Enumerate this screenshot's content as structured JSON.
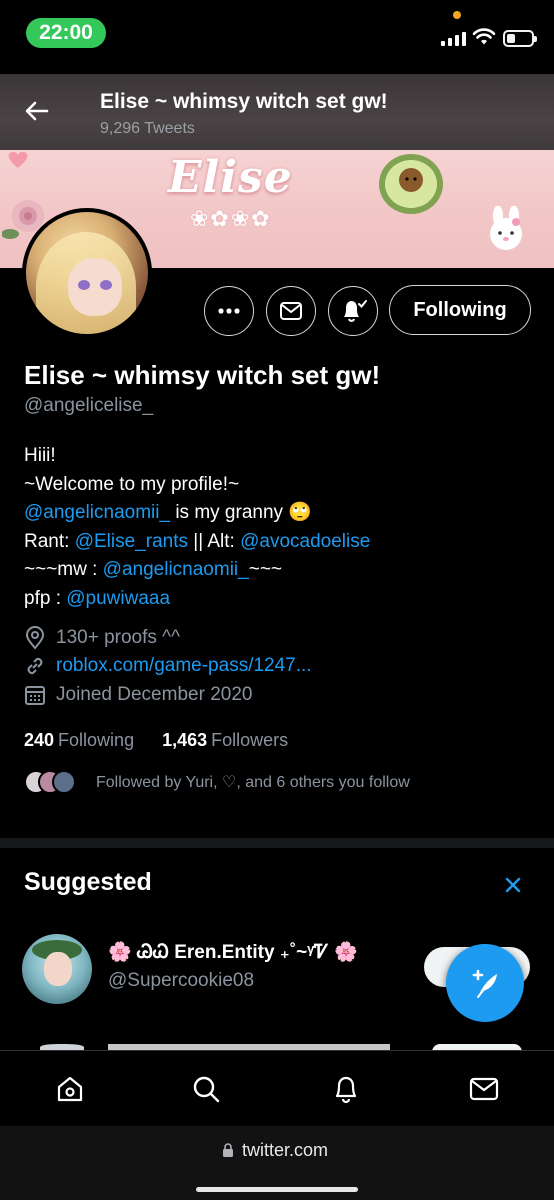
{
  "status": {
    "time": "22:00",
    "accent": "#34c759"
  },
  "header": {
    "title": "Elise ~ whimsy witch set gw!",
    "tweet_count": "9,296 Tweets",
    "back_icon": "back-arrow-icon"
  },
  "banner": {
    "name": "Elise",
    "flowers": "❀✿❀✿"
  },
  "actions": {
    "more_icon": "more-icon",
    "message_icon": "mail-icon",
    "notify_icon": "bell-icon",
    "follow_label": "Following"
  },
  "profile": {
    "display_name": "Elise ~ whimsy witch set gw!",
    "handle": "@angelicelise_",
    "bio": {
      "line1": "Hiii!",
      "line2": "~Welcome to my profile!~",
      "line3_link": "@angelicnaomii_",
      "line3_text": " is my granny 🙄",
      "line4_prefix": "Rant: ",
      "line4_link1": "@Elise_rants",
      "line4_mid": " || Alt: ",
      "line4_link2": "@avocadoelise",
      "line5_prefix": "~~~mw : ",
      "line5_link": "@angelicnaomii_",
      "line5_suffix": "~~~",
      "line6_prefix": "pfp : ",
      "line6_link": "@puwiwaaa"
    },
    "location": "130+ proofs ^^",
    "website": "roblox.com/game-pass/1247...",
    "joined": "Joined December 2020",
    "following_count": "240",
    "following_label": "Following",
    "followers_count": "1,463",
    "followers_label": "Followers",
    "followed_by": "Followed by Yuri, ♡, and 6 others you follow"
  },
  "suggested": {
    "title": "Suggested",
    "items": [
      {
        "name": "🌸 ᏊᏇ Eren.Entity ₊˚~ᵞᏤ 🌸",
        "handle": "@Supercookie08"
      }
    ]
  },
  "nav": {
    "home_icon": "home-icon",
    "search_icon": "search-icon",
    "notifications_icon": "bell-icon",
    "messages_icon": "mail-icon"
  },
  "browser": {
    "url": "twitter.com"
  },
  "colors": {
    "link": "#1d9bf0",
    "fab": "#1d9bf0",
    "banner": "#f2c6c7"
  }
}
